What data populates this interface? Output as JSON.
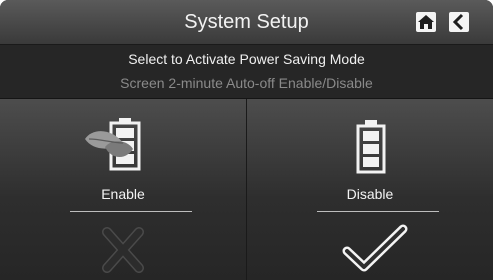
{
  "header": {
    "title": "System Setup",
    "home_icon": "home-icon",
    "back_icon": "back-arrow-icon"
  },
  "info": {
    "line1": "Select to Activate Power Saving Mode",
    "line2": "Screen 2-minute Auto-off Enable/Disable"
  },
  "options": {
    "enable": {
      "label": "Enable",
      "icon": "eco-battery-icon",
      "status_icon": "cross-icon",
      "selected": false
    },
    "disable": {
      "label": "Disable",
      "icon": "battery-icon",
      "status_icon": "checkmark-icon",
      "selected": true
    }
  },
  "colors": {
    "background": "#2a2a2a",
    "text": "#f2f2f2",
    "muted_text": "#8a8a8a"
  }
}
